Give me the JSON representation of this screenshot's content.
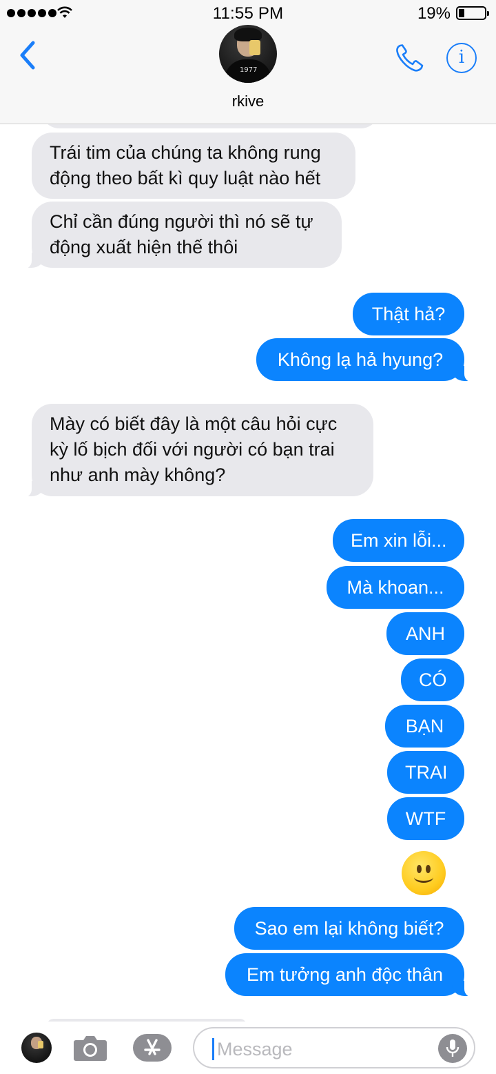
{
  "status_bar": {
    "time": "11:55 PM",
    "battery_percent": "19%"
  },
  "header": {
    "contact_name": "rkive"
  },
  "messages": [
    {
      "text_lines": [
        "Trái tim của chúng ta không rung",
        "động theo bất kì quy luật nào hết"
      ]
    },
    {
      "text_lines": [
        "Chỉ cần đúng người thì nó sẽ tự",
        "động xuất hiện thế thôi"
      ]
    },
    {
      "text": "Thật hả?"
    },
    {
      "text": "Không lạ hả hyung?"
    },
    {
      "text_lines": [
        "Mày có biết đây là một câu hỏi cực",
        "kỳ lố bịch đối với người có bạn trai",
        "như anh mày không?"
      ]
    },
    {
      "text": "Em xin lỗi..."
    },
    {
      "text": "Mà khoan..."
    },
    {
      "text": "ANH"
    },
    {
      "text": "CÓ"
    },
    {
      "text": "BẠN"
    },
    {
      "text": "TRAI"
    },
    {
      "text": "WTF"
    },
    {
      "emoji": "slightly-smiling-face"
    },
    {
      "text": "Sao em lại không biết?"
    },
    {
      "text": "Em tưởng anh độc thân"
    }
  ],
  "input_bar": {
    "placeholder": "Message"
  },
  "colors": {
    "accent": "#1a7ef9",
    "outgoing_bubble": "#0b84fe",
    "incoming_bubble": "#e8e8ec"
  }
}
